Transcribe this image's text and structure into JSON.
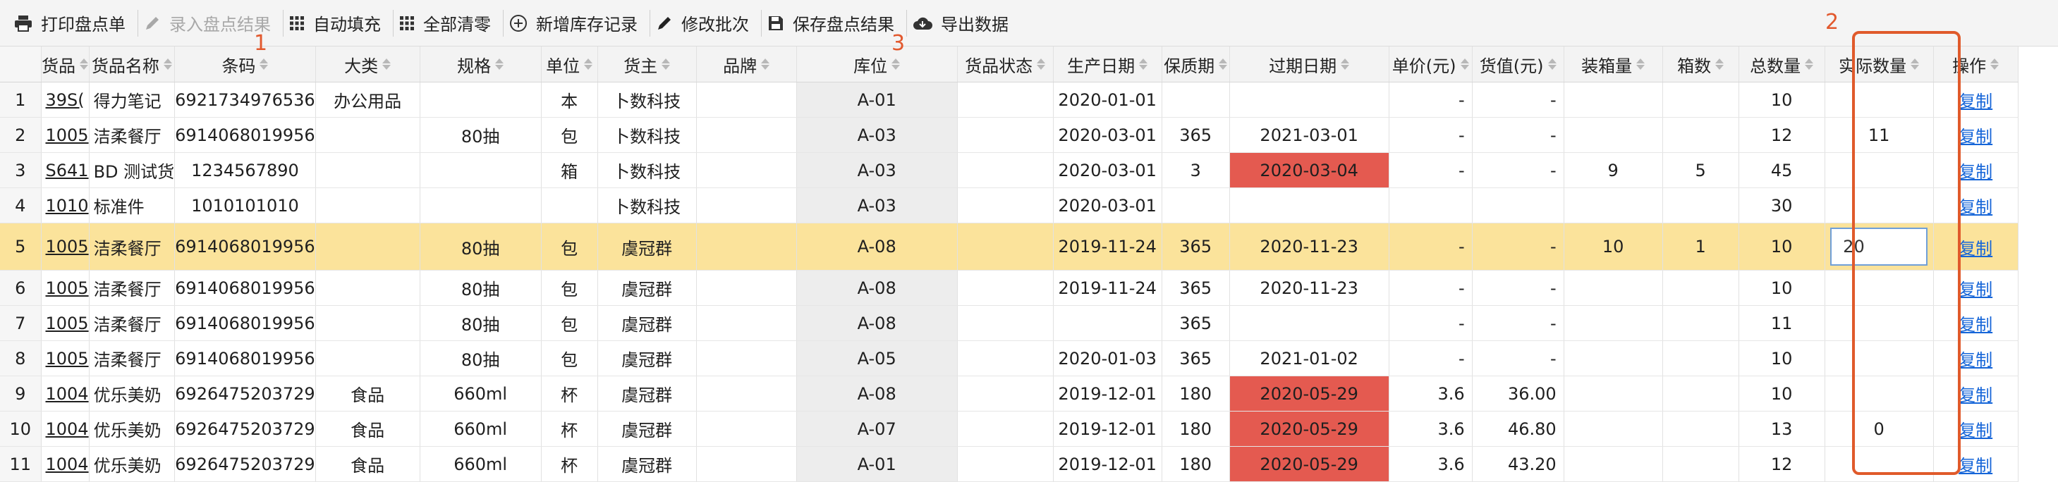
{
  "toolbar": {
    "buttons": [
      {
        "label": "打印盘点单",
        "icon": "printer-icon",
        "enabled": true
      },
      {
        "label": "录入盘点结果",
        "icon": "pencil-icon",
        "enabled": false
      },
      {
        "label": "自动填充",
        "icon": "grid-icon",
        "enabled": true
      },
      {
        "label": "全部清零",
        "icon": "grid-icon",
        "enabled": true
      },
      {
        "label": "新增库存记录",
        "icon": "plus-circle-icon",
        "enabled": true
      },
      {
        "label": "修改批次",
        "icon": "pencil-icon",
        "enabled": true
      },
      {
        "label": "保存盘点结果",
        "icon": "save-icon",
        "enabled": true
      },
      {
        "label": "导出数据",
        "icon": "cloud-download-icon",
        "enabled": true
      }
    ]
  },
  "annotations": {
    "mark1": "1",
    "mark2": "2",
    "mark3": "3"
  },
  "colors": {
    "accent_red": "#e05a2b",
    "expired_bg": "#e45a50",
    "selected_row": "#fbe39b",
    "link": "#1565d8"
  },
  "table": {
    "columns": [
      "",
      "货品",
      "货品名称",
      "条码",
      "大类",
      "规格",
      "单位",
      "货主",
      "品牌",
      "库位",
      "货品状态",
      "生产日期",
      "保质期",
      "过期日期",
      "单价(元)",
      "货值(元)",
      "装箱量",
      "箱数",
      "总数量",
      "实际数量",
      "操作"
    ],
    "sortable": [
      false,
      true,
      true,
      true,
      true,
      true,
      true,
      true,
      true,
      true,
      true,
      true,
      true,
      true,
      true,
      true,
      true,
      true,
      true,
      true,
      true
    ],
    "rows": [
      {
        "n": "1",
        "code": "39S(",
        "name": "得力笔记",
        "barcode": "6921734976536",
        "category": "办公用品",
        "spec": "",
        "unit": "本",
        "owner": "卜数科技",
        "brand": "",
        "location": "A-01",
        "status": "",
        "prod": "2020-01-01",
        "shelf": "",
        "exp": "",
        "price": "-",
        "value": "-",
        "pack": "",
        "boxes": "",
        "total": "10",
        "actual": "",
        "op": "复制",
        "expired": false,
        "selected": false
      },
      {
        "n": "2",
        "code": "1005",
        "name": "洁柔餐厅",
        "barcode": "6914068019956",
        "category": "",
        "spec": "80抽",
        "unit": "包",
        "owner": "卜数科技",
        "brand": "",
        "location": "A-03",
        "status": "",
        "prod": "2020-03-01",
        "shelf": "365",
        "exp": "2021-03-01",
        "price": "-",
        "value": "-",
        "pack": "",
        "boxes": "",
        "total": "12",
        "actual": "11",
        "op": "复制",
        "expired": false,
        "selected": false
      },
      {
        "n": "3",
        "code": "S641",
        "name": "BD 测试货",
        "barcode": "1234567890",
        "category": "",
        "spec": "",
        "unit": "箱",
        "owner": "卜数科技",
        "brand": "",
        "location": "A-03",
        "status": "",
        "prod": "2020-03-01",
        "shelf": "3",
        "exp": "2020-03-04",
        "price": "-",
        "value": "-",
        "pack": "9",
        "boxes": "5",
        "total": "45",
        "actual": "",
        "op": "复制",
        "expired": true,
        "selected": false
      },
      {
        "n": "4",
        "code": "1010",
        "name": "标准件",
        "barcode": "1010101010",
        "category": "",
        "spec": "",
        "unit": "",
        "owner": "卜数科技",
        "brand": "",
        "location": "A-03",
        "status": "",
        "prod": "2020-03-01",
        "shelf": "",
        "exp": "",
        "price": "",
        "value": "",
        "pack": "",
        "boxes": "",
        "total": "30",
        "actual": "",
        "op": "复制",
        "expired": false,
        "selected": false
      },
      {
        "n": "5",
        "code": "1005",
        "name": "洁柔餐厅",
        "barcode": "6914068019956",
        "category": "",
        "spec": "80抽",
        "unit": "包",
        "owner": "虞冠群",
        "brand": "",
        "location": "A-08",
        "status": "",
        "prod": "2019-11-24",
        "shelf": "365",
        "exp": "2020-11-23",
        "price": "-",
        "value": "-",
        "pack": "10",
        "boxes": "1",
        "total": "10",
        "actual": "20",
        "op": "复制",
        "expired": false,
        "selected": true
      },
      {
        "n": "6",
        "code": "1005",
        "name": "洁柔餐厅",
        "barcode": "6914068019956",
        "category": "",
        "spec": "80抽",
        "unit": "包",
        "owner": "虞冠群",
        "brand": "",
        "location": "A-08",
        "status": "",
        "prod": "2019-11-24",
        "shelf": "365",
        "exp": "2020-11-23",
        "price": "-",
        "value": "-",
        "pack": "",
        "boxes": "",
        "total": "10",
        "actual": "",
        "op": "复制",
        "expired": false,
        "selected": false
      },
      {
        "n": "7",
        "code": "1005",
        "name": "洁柔餐厅",
        "barcode": "6914068019956",
        "category": "",
        "spec": "80抽",
        "unit": "包",
        "owner": "虞冠群",
        "brand": "",
        "location": "A-08",
        "status": "",
        "prod": "",
        "shelf": "365",
        "exp": "",
        "price": "-",
        "value": "-",
        "pack": "",
        "boxes": "",
        "total": "11",
        "actual": "",
        "op": "复制",
        "expired": false,
        "selected": false
      },
      {
        "n": "8",
        "code": "1005",
        "name": "洁柔餐厅",
        "barcode": "6914068019956",
        "category": "",
        "spec": "80抽",
        "unit": "包",
        "owner": "虞冠群",
        "brand": "",
        "location": "A-05",
        "status": "",
        "prod": "2020-01-03",
        "shelf": "365",
        "exp": "2021-01-02",
        "price": "-",
        "value": "-",
        "pack": "",
        "boxes": "",
        "total": "10",
        "actual": "",
        "op": "复制",
        "expired": false,
        "selected": false
      },
      {
        "n": "9",
        "code": "1004",
        "name": "优乐美奶",
        "barcode": "6926475203729",
        "category": "食品",
        "spec": "660ml",
        "unit": "杯",
        "owner": "虞冠群",
        "brand": "",
        "location": "A-08",
        "status": "",
        "prod": "2019-12-01",
        "shelf": "180",
        "exp": "2020-05-29",
        "price": "3.6",
        "value": "36.00",
        "pack": "",
        "boxes": "",
        "total": "10",
        "actual": "",
        "op": "复制",
        "expired": true,
        "selected": false
      },
      {
        "n": "10",
        "code": "1004",
        "name": "优乐美奶",
        "barcode": "6926475203729",
        "category": "食品",
        "spec": "660ml",
        "unit": "杯",
        "owner": "虞冠群",
        "brand": "",
        "location": "A-07",
        "status": "",
        "prod": "2019-12-01",
        "shelf": "180",
        "exp": "2020-05-29",
        "price": "3.6",
        "value": "46.80",
        "pack": "",
        "boxes": "",
        "total": "13",
        "actual": "0",
        "op": "复制",
        "expired": true,
        "selected": false
      },
      {
        "n": "11",
        "code": "1004",
        "name": "优乐美奶",
        "barcode": "6926475203729",
        "category": "食品",
        "spec": "660ml",
        "unit": "杯",
        "owner": "虞冠群",
        "brand": "",
        "location": "A-01",
        "status": "",
        "prod": "2019-12-01",
        "shelf": "180",
        "exp": "2020-05-29",
        "price": "3.6",
        "value": "43.20",
        "pack": "",
        "boxes": "",
        "total": "12",
        "actual": "",
        "op": "复制",
        "expired": true,
        "selected": false
      }
    ]
  }
}
